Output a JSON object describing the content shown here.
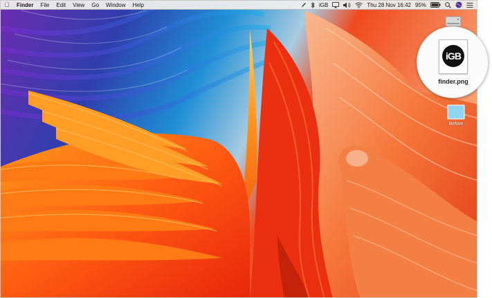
{
  "menubar": {
    "app_name": "Finder",
    "menus": [
      "File",
      "Edit",
      "View",
      "Go",
      "Window",
      "Help"
    ],
    "status": {
      "keyboard_label": "iGB",
      "datetime": "Thu 28 Nov 16:42",
      "battery": "95%"
    }
  },
  "desktop": {
    "file_label": "Before",
    "magnified_file_name": "finder.png",
    "logo_text": "iGB"
  }
}
